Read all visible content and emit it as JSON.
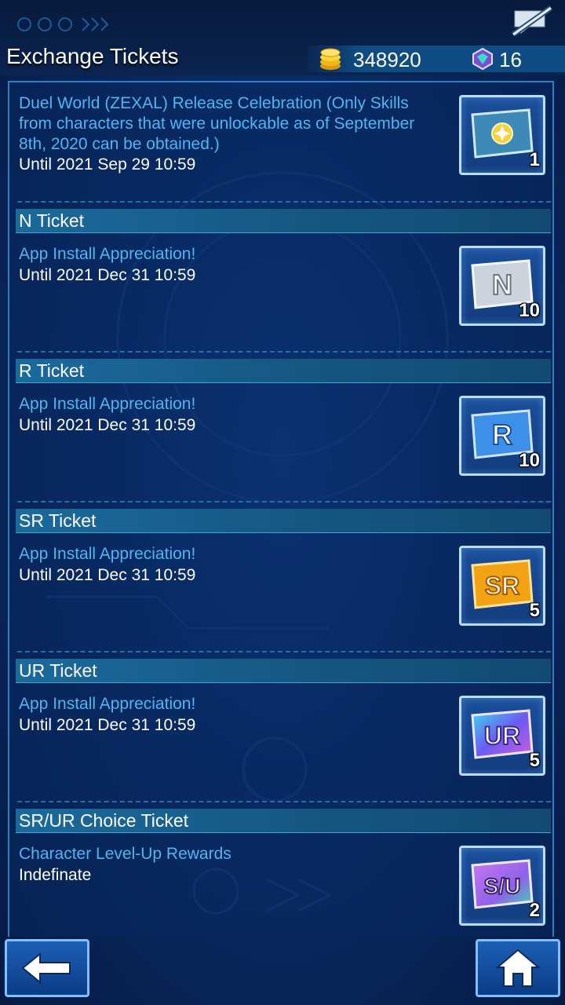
{
  "header": {
    "title": "Exchange Tickets",
    "gold": "348920",
    "gems": "16"
  },
  "sections": [
    {
      "header": "",
      "event": "Duel World (ZEXAL) Release Celebration (Only Skills from characters that were unlockable as of September 8th, 2020 can be obtained.)",
      "until": "Until 2021 Sep 29 10:59",
      "ticket_label": "",
      "count": "1",
      "ticket_color": "#2a7bb8"
    },
    {
      "header": "N Ticket",
      "event": "App Install Appreciation!",
      "until": "Until 2021 Dec 31 10:59",
      "ticket_label": "N",
      "count": "10",
      "ticket_color": "#c9ced6"
    },
    {
      "header": "R Ticket",
      "event": "App Install Appreciation!",
      "until": "Until 2021 Dec 31 10:59",
      "ticket_label": "R",
      "count": "10",
      "ticket_color": "#3d8fe8"
    },
    {
      "header": "SR Ticket",
      "event": "App Install Appreciation!",
      "until": "Until 2021 Dec 31 10:59",
      "ticket_label": "SR",
      "count": "5",
      "ticket_color": "#f2a313"
    },
    {
      "header": "UR Ticket",
      "event": "App Install Appreciation!",
      "until": "Until 2021 Dec 31 10:59",
      "ticket_label": "UR",
      "count": "5",
      "ticket_color": "#6a5cf0"
    },
    {
      "header": "SR/UR Choice Ticket",
      "event": "Character Level-Up Rewards",
      "until": "Indefinate",
      "ticket_label": "S/U",
      "count": "2",
      "ticket_color": "#8e62e8"
    }
  ],
  "icons": {
    "back": "back-arrow-icon",
    "home": "home-icon",
    "chat": "chat-off-icon",
    "gold": "gold-coins-icon",
    "gem": "gem-icon"
  }
}
